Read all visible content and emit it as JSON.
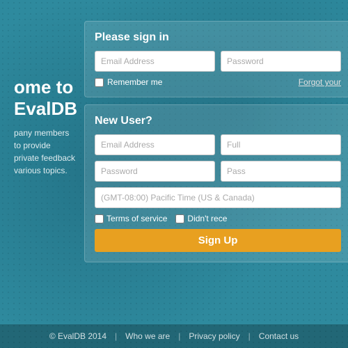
{
  "background": {
    "color": "#2e8a9e"
  },
  "left_panel": {
    "heading": "ome to EvalDB",
    "description": "pany members to provide private feedback\nvarious topics."
  },
  "signin_form": {
    "title": "Please sign in",
    "email_placeholder": "Email Address",
    "password_placeholder": "Password",
    "remember_label": "Remember me",
    "forgot_label": "Forgot your",
    "remember_checked": false
  },
  "signup_form": {
    "title": "New User?",
    "email_placeholder": "Email Address",
    "fullname_placeholder": "Full",
    "password_placeholder": "Password",
    "password2_placeholder": "Pass",
    "timezone_placeholder": "(GMT-08:00) Pacific Time (US & Canada)",
    "terms_label": "Terms of service",
    "didnt_label": "Didn't rece",
    "signup_button": "Sign Up"
  },
  "footer": {
    "copyright": "© EvalDB 2014",
    "links": [
      "Who we are",
      "Privacy policy",
      "Contact us"
    ]
  }
}
